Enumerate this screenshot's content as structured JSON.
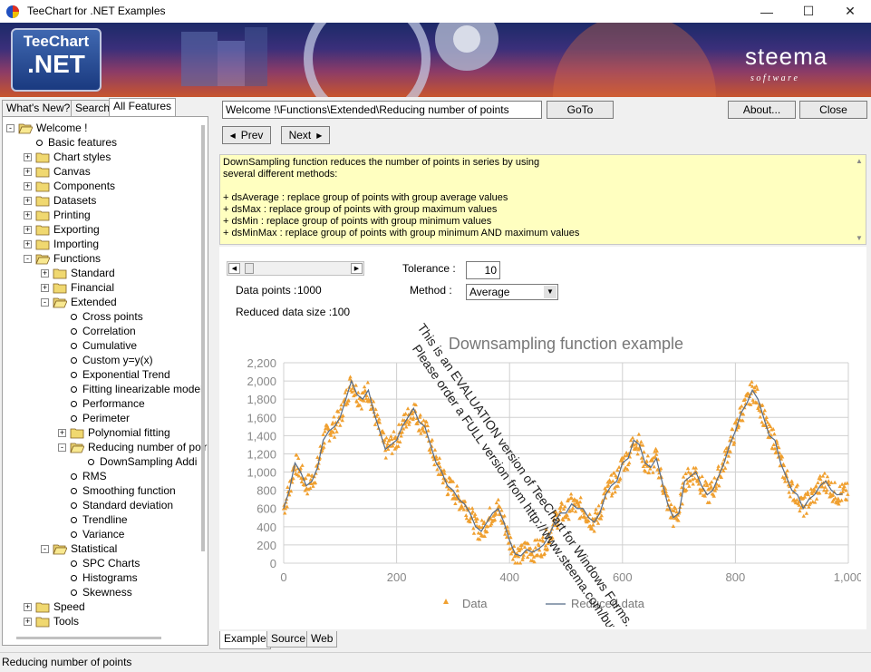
{
  "window": {
    "title": "TeeChart for .NET Examples",
    "minimize": "—",
    "maximize": "☐",
    "close": "✕"
  },
  "banner": {
    "logo_top": "TeeChart",
    "logo_bottom": ".NET",
    "brand": "steema",
    "brand_sub": "s o f t w a r e"
  },
  "left_tabs": [
    "What's New?",
    "Search",
    "All Features"
  ],
  "tree": [
    {
      "label": "Welcome !",
      "level": 0,
      "type": "folder",
      "expander": "-",
      "open": true
    },
    {
      "label": "Basic features",
      "level": 1,
      "type": "leaf"
    },
    {
      "label": "Chart styles",
      "level": 1,
      "type": "folder",
      "expander": "+"
    },
    {
      "label": "Canvas",
      "level": 1,
      "type": "folder",
      "expander": "+"
    },
    {
      "label": "Components",
      "level": 1,
      "type": "folder",
      "expander": "+"
    },
    {
      "label": "Datasets",
      "level": 1,
      "type": "folder",
      "expander": "+"
    },
    {
      "label": "Printing",
      "level": 1,
      "type": "folder",
      "expander": "+"
    },
    {
      "label": "Exporting",
      "level": 1,
      "type": "folder",
      "expander": "+"
    },
    {
      "label": "Importing",
      "level": 1,
      "type": "folder",
      "expander": "+"
    },
    {
      "label": "Functions",
      "level": 1,
      "type": "folder",
      "expander": "-",
      "open": true
    },
    {
      "label": "Standard",
      "level": 2,
      "type": "folder",
      "expander": "+"
    },
    {
      "label": "Financial",
      "level": 2,
      "type": "folder",
      "expander": "+"
    },
    {
      "label": "Extended",
      "level": 2,
      "type": "folder",
      "expander": "-",
      "open": true
    },
    {
      "label": "Cross points",
      "level": 3,
      "type": "leaf"
    },
    {
      "label": "Correlation",
      "level": 3,
      "type": "leaf"
    },
    {
      "label": "Cumulative",
      "level": 3,
      "type": "leaf"
    },
    {
      "label": "Custom y=y(x)",
      "level": 3,
      "type": "leaf"
    },
    {
      "label": "Exponential Trend",
      "level": 3,
      "type": "leaf"
    },
    {
      "label": "Fitting linearizable model",
      "level": 3,
      "type": "leaf"
    },
    {
      "label": "Performance",
      "level": 3,
      "type": "leaf"
    },
    {
      "label": "Perimeter",
      "level": 3,
      "type": "leaf"
    },
    {
      "label": "Polynomial fitting",
      "level": 3,
      "type": "folder",
      "expander": "+"
    },
    {
      "label": "Reducing number of poir",
      "level": 3,
      "type": "folder",
      "expander": "-",
      "open": true
    },
    {
      "label": "DownSampling Addi",
      "level": 4,
      "type": "leaf"
    },
    {
      "label": "RMS",
      "level": 3,
      "type": "leaf"
    },
    {
      "label": "Smoothing function",
      "level": 3,
      "type": "leaf"
    },
    {
      "label": "Standard deviation",
      "level": 3,
      "type": "leaf"
    },
    {
      "label": "Trendline",
      "level": 3,
      "type": "leaf"
    },
    {
      "label": "Variance",
      "level": 3,
      "type": "leaf"
    },
    {
      "label": "Statistical",
      "level": 2,
      "type": "folder",
      "expander": "-",
      "open": true
    },
    {
      "label": "SPC Charts",
      "level": 3,
      "type": "leaf"
    },
    {
      "label": "Histograms",
      "level": 3,
      "type": "leaf"
    },
    {
      "label": "Skewness",
      "level": 3,
      "type": "leaf"
    },
    {
      "label": "Speed",
      "level": 1,
      "type": "folder",
      "expander": "+"
    },
    {
      "label": "Tools",
      "level": 1,
      "type": "folder",
      "expander": "+"
    }
  ],
  "nav": {
    "path": "Welcome !\\Functions\\Extended\\Reducing number of points",
    "goto": "GoTo",
    "about": "About...",
    "close": "Close",
    "prev": "Prev",
    "next": "Next"
  },
  "description": [
    "DownSampling function reduces the number of points in series by using",
    "several different methods:",
    "",
    "+ dsAverage : replace group of points with group average values",
    "+ dsMax : replace group of points with group maximum values",
    "+ dsMin : replace group of points with group minimum values",
    "+ dsMinMax : replace group of points with group minimum AND maximum values"
  ],
  "controls": {
    "tolerance_label": "Tolerance :",
    "tolerance_value": "10",
    "data_points_label": "Data points :",
    "data_points_value": "1000",
    "method_label": "Method :",
    "method_value": "Average",
    "reduced_label": "Reduced data size :",
    "reduced_value": "100",
    "slider_fraction": 0.03
  },
  "watermark": {
    "line1": "This is an EVALUATION version of TeeChart for Windows Forms.",
    "line2": "Please order a FULL version from http://www.steema.com/buy"
  },
  "bottom_tabs": [
    "Example",
    "Source",
    "Web"
  ],
  "status": "Reducing number of points",
  "chart_data": {
    "type": "scatter",
    "title": "Downsampling function example",
    "xlim": [
      0,
      1000
    ],
    "ylim": [
      0,
      2200
    ],
    "xticks": [
      0,
      200,
      400,
      600,
      800,
      1000
    ],
    "xtick_labels": [
      "0",
      "200",
      "400",
      "600",
      "800",
      "1,000"
    ],
    "yticks": [
      0,
      200,
      400,
      600,
      800,
      1000,
      1200,
      1400,
      1600,
      1800,
      2000,
      2200
    ],
    "ytick_labels": [
      "0",
      "200",
      "400",
      "600",
      "800",
      "1,000",
      "1,200",
      "1,400",
      "1,600",
      "1,800",
      "2,000",
      "2,200"
    ],
    "grid": true,
    "legend_position": "bottom",
    "series": [
      {
        "name": "Data",
        "kind": "triangle-points",
        "color": "#f0a030",
        "jitter": 120,
        "points_per_segment": 10
      },
      {
        "name": "Reduced data",
        "kind": "line",
        "color": "#556b88",
        "x": [
          0,
          10,
          20,
          30,
          40,
          50,
          60,
          70,
          80,
          90,
          100,
          110,
          120,
          130,
          140,
          150,
          160,
          170,
          180,
          190,
          200,
          210,
          220,
          230,
          240,
          250,
          260,
          270,
          280,
          290,
          300,
          310,
          320,
          330,
          340,
          350,
          360,
          370,
          380,
          390,
          400,
          410,
          420,
          430,
          440,
          450,
          460,
          470,
          480,
          490,
          500,
          510,
          520,
          530,
          540,
          550,
          560,
          570,
          580,
          590,
          600,
          610,
          620,
          630,
          640,
          650,
          660,
          670,
          680,
          690,
          700,
          710,
          720,
          730,
          740,
          750,
          760,
          770,
          780,
          790,
          800,
          810,
          820,
          830,
          840,
          850,
          860,
          870,
          880,
          890,
          900,
          910,
          920,
          930,
          940,
          950,
          960,
          970,
          980,
          990
        ],
        "y": [
          600,
          800,
          1100,
          1000,
          850,
          900,
          1050,
          1350,
          1450,
          1500,
          1600,
          1800,
          2000,
          1850,
          1800,
          1900,
          1650,
          1450,
          1250,
          1300,
          1350,
          1500,
          1600,
          1700,
          1550,
          1500,
          1300,
          1100,
          1000,
          850,
          800,
          700,
          650,
          550,
          400,
          350,
          450,
          550,
          600,
          450,
          250,
          100,
          80,
          150,
          120,
          150,
          200,
          300,
          450,
          550,
          550,
          650,
          600,
          600,
          500,
          450,
          550,
          750,
          850,
          900,
          1100,
          1150,
          1350,
          1300,
          1100,
          1050,
          1150,
          900,
          650,
          500,
          550,
          900,
          950,
          1000,
          850,
          750,
          800,
          950,
          1100,
          1300,
          1450,
          1650,
          1750,
          1900,
          1800,
          1600,
          1400,
          1350,
          1100,
          950,
          800,
          750,
          600,
          700,
          750,
          850,
          900,
          800,
          750,
          760
        ]
      }
    ]
  }
}
